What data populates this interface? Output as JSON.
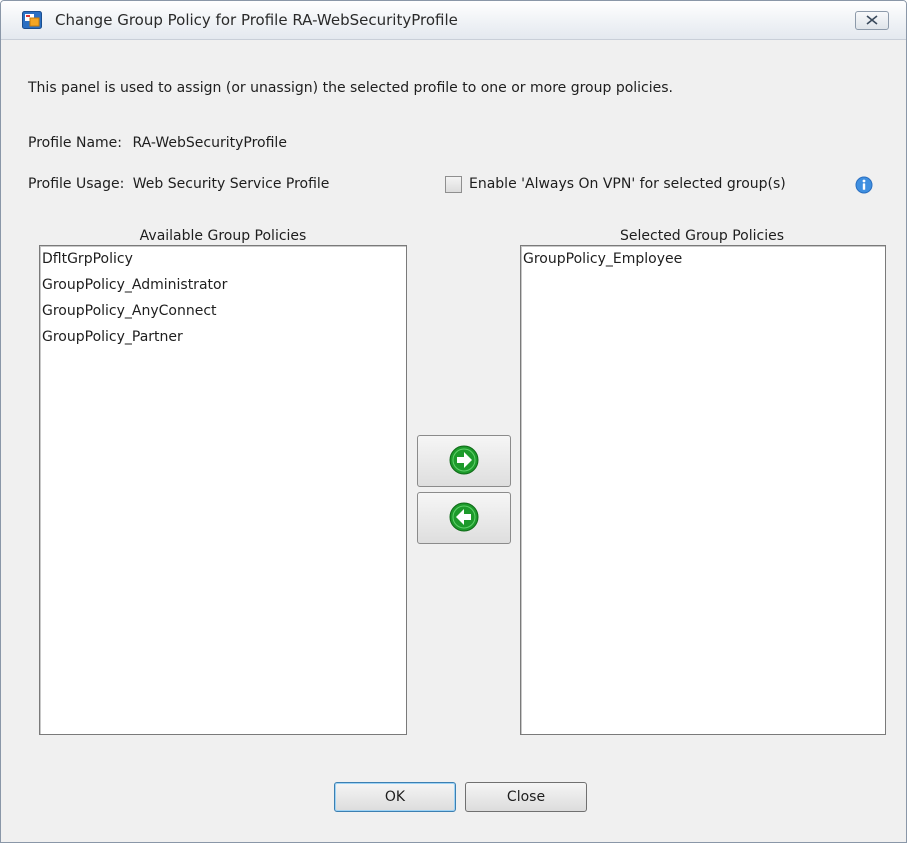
{
  "window": {
    "title": "Change Group Policy for Profile RA-WebSecurityProfile",
    "app_icon": "asdm-app-icon",
    "close_icon": "close-x-icon"
  },
  "panel": {
    "description": "This panel is used to assign (or unassign) the selected profile to one or more group policies.",
    "profile_name_label": "Profile Name:",
    "profile_name_value": "RA-WebSecurityProfile",
    "profile_usage_label": "Profile Usage:",
    "profile_usage_value": "Web Security Service Profile",
    "always_on_checkbox_label": "Enable 'Always On VPN' for selected group(s)",
    "always_on_checked": false
  },
  "available": {
    "header": "Available Group Policies",
    "items": [
      "DfltGrpPolicy",
      "GroupPolicy_Administrator",
      "GroupPolicy_AnyConnect",
      "GroupPolicy_Partner"
    ]
  },
  "selected": {
    "header": "Selected Group Policies",
    "items": [
      "GroupPolicy_Employee"
    ]
  },
  "buttons": {
    "add_icon": "arrow-right-icon",
    "remove_icon": "arrow-left-icon",
    "ok_label": "OK",
    "close_label": "Close"
  },
  "colors": {
    "arrow_green": "#1d9a2b",
    "info_blue": "#3f8fe0"
  }
}
